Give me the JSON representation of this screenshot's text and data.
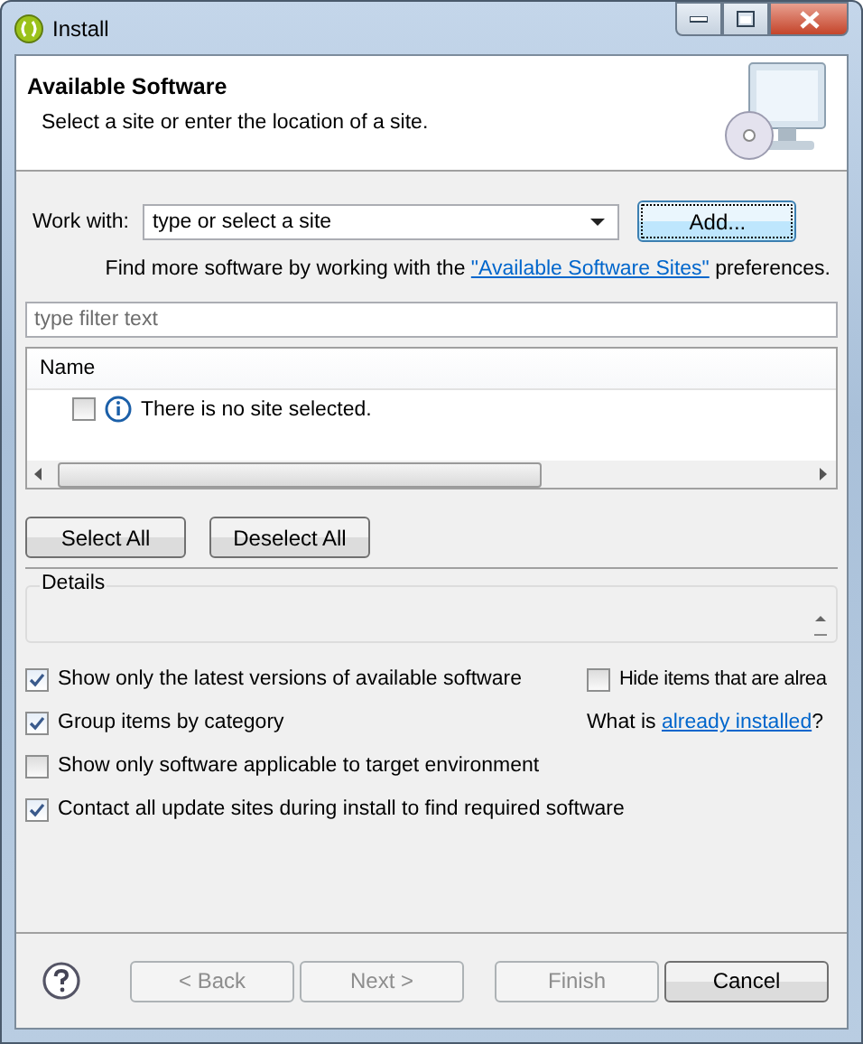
{
  "window": {
    "title": "Install"
  },
  "header": {
    "title": "Available Software",
    "description": "Select a site or enter the location of a site."
  },
  "work_with": {
    "label": "Work with:",
    "placeholder": "type or select a site",
    "button": "Add..."
  },
  "sites_hint": {
    "before": "Find more software by working with the ",
    "link": "\"Available Software Sites\"",
    "after": " preferences."
  },
  "filter": {
    "placeholder": "type filter text"
  },
  "table": {
    "columns": [
      "Name"
    ],
    "rows": [
      {
        "checked": false,
        "text": "There is no site selected."
      }
    ]
  },
  "selection_buttons": [
    "Select All",
    "Deselect All"
  ],
  "details": {
    "label": "Details"
  },
  "options": [
    {
      "label": "Show only the latest versions of available software",
      "checked": true
    },
    {
      "label": "Group items by category",
      "checked": true
    },
    {
      "label": "Show only software applicable to target environment",
      "checked": false
    },
    {
      "label": "Contact all update sites during install to find required software",
      "checked": true
    }
  ],
  "hide_installed": {
    "label": "Hide items that are alrea",
    "checked": false
  },
  "installed_hint": {
    "before": "What is ",
    "link": "already installed",
    "after": "?"
  },
  "buttons": [
    {
      "label": "< Back",
      "disabled": true
    },
    {
      "label": "Next >",
      "disabled": true
    },
    {
      "label": "Finish",
      "disabled": true
    },
    {
      "label": "Cancel",
      "disabled": false
    }
  ]
}
